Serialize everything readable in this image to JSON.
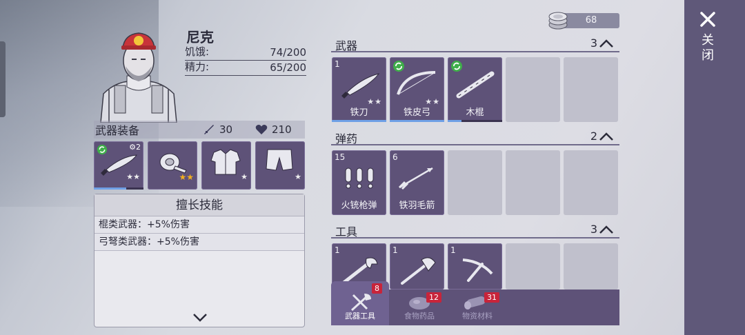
{
  "character": {
    "name": "尼克",
    "stats": [
      {
        "label": "饥饿:",
        "value": "74/200"
      },
      {
        "label": "精力:",
        "value": "65/200"
      }
    ]
  },
  "equipment": {
    "title": "武器装备",
    "attack": "30",
    "health": "210",
    "slots": [
      {
        "name": "machete",
        "badge": "2",
        "stars": "★★",
        "progress": 0.65,
        "cycle": true
      },
      {
        "name": "bandage-roll",
        "stars": "★★",
        "star_color": "#f2b01e"
      },
      {
        "name": "vest",
        "stars": "★"
      },
      {
        "name": "pants",
        "stars": "★"
      }
    ]
  },
  "skills": {
    "title": "擅长技能",
    "items": [
      "棍类武器：+5%伤害",
      "弓弩类武器：+5%伤害"
    ]
  },
  "currency": {
    "amount": "68",
    "icon": "coin-stack-icon"
  },
  "sections": [
    {
      "label": "武器",
      "count": "3",
      "items": [
        {
          "qty": "1",
          "label": "铁刀",
          "stars": "★★",
          "progress": 1.0
        },
        {
          "qty": "",
          "label": "铁皮弓",
          "stars": "★★",
          "progress": 1.0,
          "cycle": true
        },
        {
          "qty": "",
          "label": "木棍",
          "stars": "",
          "progress": 0.25,
          "cycle": true
        }
      ]
    },
    {
      "label": "弹药",
      "count": "2",
      "items": [
        {
          "qty": "15",
          "label": "火铳枪弹"
        },
        {
          "qty": "6",
          "label": "铁羽毛箭"
        }
      ]
    },
    {
      "label": "工具",
      "count": "3",
      "items": [
        {
          "qty": "1",
          "label": ""
        },
        {
          "qty": "1",
          "label": ""
        },
        {
          "qty": "1",
          "label": ""
        }
      ]
    }
  ],
  "tabs": [
    {
      "label": "武器工具",
      "badge": "8",
      "active": true
    },
    {
      "label": "食物药品",
      "badge": "12",
      "active": false
    },
    {
      "label": "物资材料",
      "badge": "31",
      "active": false
    }
  ],
  "close": {
    "label": "关闭"
  },
  "colors": {
    "panel": "#5e5278",
    "accent": "#6f6291",
    "badge": "#c8243a",
    "bar": "#6fa0e6"
  }
}
